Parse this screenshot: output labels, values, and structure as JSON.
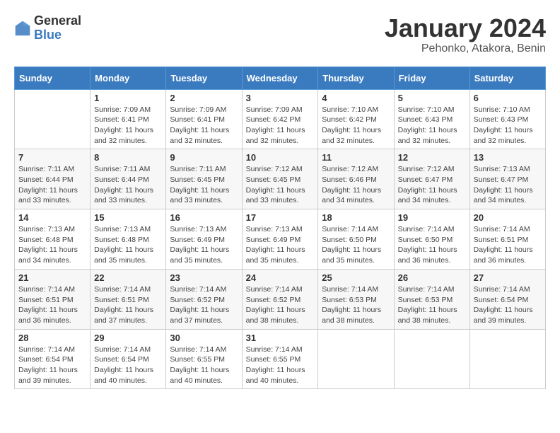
{
  "logo": {
    "general": "General",
    "blue": "Blue"
  },
  "calendar": {
    "title": "January 2024",
    "subtitle": "Pehonko, Atakora, Benin"
  },
  "headers": [
    "Sunday",
    "Monday",
    "Tuesday",
    "Wednesday",
    "Thursday",
    "Friday",
    "Saturday"
  ],
  "weeks": [
    [
      {
        "day": "",
        "sunrise": "",
        "sunset": "",
        "daylight": ""
      },
      {
        "day": "1",
        "sunrise": "Sunrise: 7:09 AM",
        "sunset": "Sunset: 6:41 PM",
        "daylight": "Daylight: 11 hours and 32 minutes."
      },
      {
        "day": "2",
        "sunrise": "Sunrise: 7:09 AM",
        "sunset": "Sunset: 6:41 PM",
        "daylight": "Daylight: 11 hours and 32 minutes."
      },
      {
        "day": "3",
        "sunrise": "Sunrise: 7:09 AM",
        "sunset": "Sunset: 6:42 PM",
        "daylight": "Daylight: 11 hours and 32 minutes."
      },
      {
        "day": "4",
        "sunrise": "Sunrise: 7:10 AM",
        "sunset": "Sunset: 6:42 PM",
        "daylight": "Daylight: 11 hours and 32 minutes."
      },
      {
        "day": "5",
        "sunrise": "Sunrise: 7:10 AM",
        "sunset": "Sunset: 6:43 PM",
        "daylight": "Daylight: 11 hours and 32 minutes."
      },
      {
        "day": "6",
        "sunrise": "Sunrise: 7:10 AM",
        "sunset": "Sunset: 6:43 PM",
        "daylight": "Daylight: 11 hours and 32 minutes."
      }
    ],
    [
      {
        "day": "7",
        "sunrise": "Sunrise: 7:11 AM",
        "sunset": "Sunset: 6:44 PM",
        "daylight": "Daylight: 11 hours and 33 minutes."
      },
      {
        "day": "8",
        "sunrise": "Sunrise: 7:11 AM",
        "sunset": "Sunset: 6:44 PM",
        "daylight": "Daylight: 11 hours and 33 minutes."
      },
      {
        "day": "9",
        "sunrise": "Sunrise: 7:11 AM",
        "sunset": "Sunset: 6:45 PM",
        "daylight": "Daylight: 11 hours and 33 minutes."
      },
      {
        "day": "10",
        "sunrise": "Sunrise: 7:12 AM",
        "sunset": "Sunset: 6:45 PM",
        "daylight": "Daylight: 11 hours and 33 minutes."
      },
      {
        "day": "11",
        "sunrise": "Sunrise: 7:12 AM",
        "sunset": "Sunset: 6:46 PM",
        "daylight": "Daylight: 11 hours and 34 minutes."
      },
      {
        "day": "12",
        "sunrise": "Sunrise: 7:12 AM",
        "sunset": "Sunset: 6:47 PM",
        "daylight": "Daylight: 11 hours and 34 minutes."
      },
      {
        "day": "13",
        "sunrise": "Sunrise: 7:13 AM",
        "sunset": "Sunset: 6:47 PM",
        "daylight": "Daylight: 11 hours and 34 minutes."
      }
    ],
    [
      {
        "day": "14",
        "sunrise": "Sunrise: 7:13 AM",
        "sunset": "Sunset: 6:48 PM",
        "daylight": "Daylight: 11 hours and 34 minutes."
      },
      {
        "day": "15",
        "sunrise": "Sunrise: 7:13 AM",
        "sunset": "Sunset: 6:48 PM",
        "daylight": "Daylight: 11 hours and 35 minutes."
      },
      {
        "day": "16",
        "sunrise": "Sunrise: 7:13 AM",
        "sunset": "Sunset: 6:49 PM",
        "daylight": "Daylight: 11 hours and 35 minutes."
      },
      {
        "day": "17",
        "sunrise": "Sunrise: 7:13 AM",
        "sunset": "Sunset: 6:49 PM",
        "daylight": "Daylight: 11 hours and 35 minutes."
      },
      {
        "day": "18",
        "sunrise": "Sunrise: 7:14 AM",
        "sunset": "Sunset: 6:50 PM",
        "daylight": "Daylight: 11 hours and 35 minutes."
      },
      {
        "day": "19",
        "sunrise": "Sunrise: 7:14 AM",
        "sunset": "Sunset: 6:50 PM",
        "daylight": "Daylight: 11 hours and 36 minutes."
      },
      {
        "day": "20",
        "sunrise": "Sunrise: 7:14 AM",
        "sunset": "Sunset: 6:51 PM",
        "daylight": "Daylight: 11 hours and 36 minutes."
      }
    ],
    [
      {
        "day": "21",
        "sunrise": "Sunrise: 7:14 AM",
        "sunset": "Sunset: 6:51 PM",
        "daylight": "Daylight: 11 hours and 36 minutes."
      },
      {
        "day": "22",
        "sunrise": "Sunrise: 7:14 AM",
        "sunset": "Sunset: 6:51 PM",
        "daylight": "Daylight: 11 hours and 37 minutes."
      },
      {
        "day": "23",
        "sunrise": "Sunrise: 7:14 AM",
        "sunset": "Sunset: 6:52 PM",
        "daylight": "Daylight: 11 hours and 37 minutes."
      },
      {
        "day": "24",
        "sunrise": "Sunrise: 7:14 AM",
        "sunset": "Sunset: 6:52 PM",
        "daylight": "Daylight: 11 hours and 38 minutes."
      },
      {
        "day": "25",
        "sunrise": "Sunrise: 7:14 AM",
        "sunset": "Sunset: 6:53 PM",
        "daylight": "Daylight: 11 hours and 38 minutes."
      },
      {
        "day": "26",
        "sunrise": "Sunrise: 7:14 AM",
        "sunset": "Sunset: 6:53 PM",
        "daylight": "Daylight: 11 hours and 38 minutes."
      },
      {
        "day": "27",
        "sunrise": "Sunrise: 7:14 AM",
        "sunset": "Sunset: 6:54 PM",
        "daylight": "Daylight: 11 hours and 39 minutes."
      }
    ],
    [
      {
        "day": "28",
        "sunrise": "Sunrise: 7:14 AM",
        "sunset": "Sunset: 6:54 PM",
        "daylight": "Daylight: 11 hours and 39 minutes."
      },
      {
        "day": "29",
        "sunrise": "Sunrise: 7:14 AM",
        "sunset": "Sunset: 6:54 PM",
        "daylight": "Daylight: 11 hours and 40 minutes."
      },
      {
        "day": "30",
        "sunrise": "Sunrise: 7:14 AM",
        "sunset": "Sunset: 6:55 PM",
        "daylight": "Daylight: 11 hours and 40 minutes."
      },
      {
        "day": "31",
        "sunrise": "Sunrise: 7:14 AM",
        "sunset": "Sunset: 6:55 PM",
        "daylight": "Daylight: 11 hours and 40 minutes."
      },
      {
        "day": "",
        "sunrise": "",
        "sunset": "",
        "daylight": ""
      },
      {
        "day": "",
        "sunrise": "",
        "sunset": "",
        "daylight": ""
      },
      {
        "day": "",
        "sunrise": "",
        "sunset": "",
        "daylight": ""
      }
    ]
  ]
}
